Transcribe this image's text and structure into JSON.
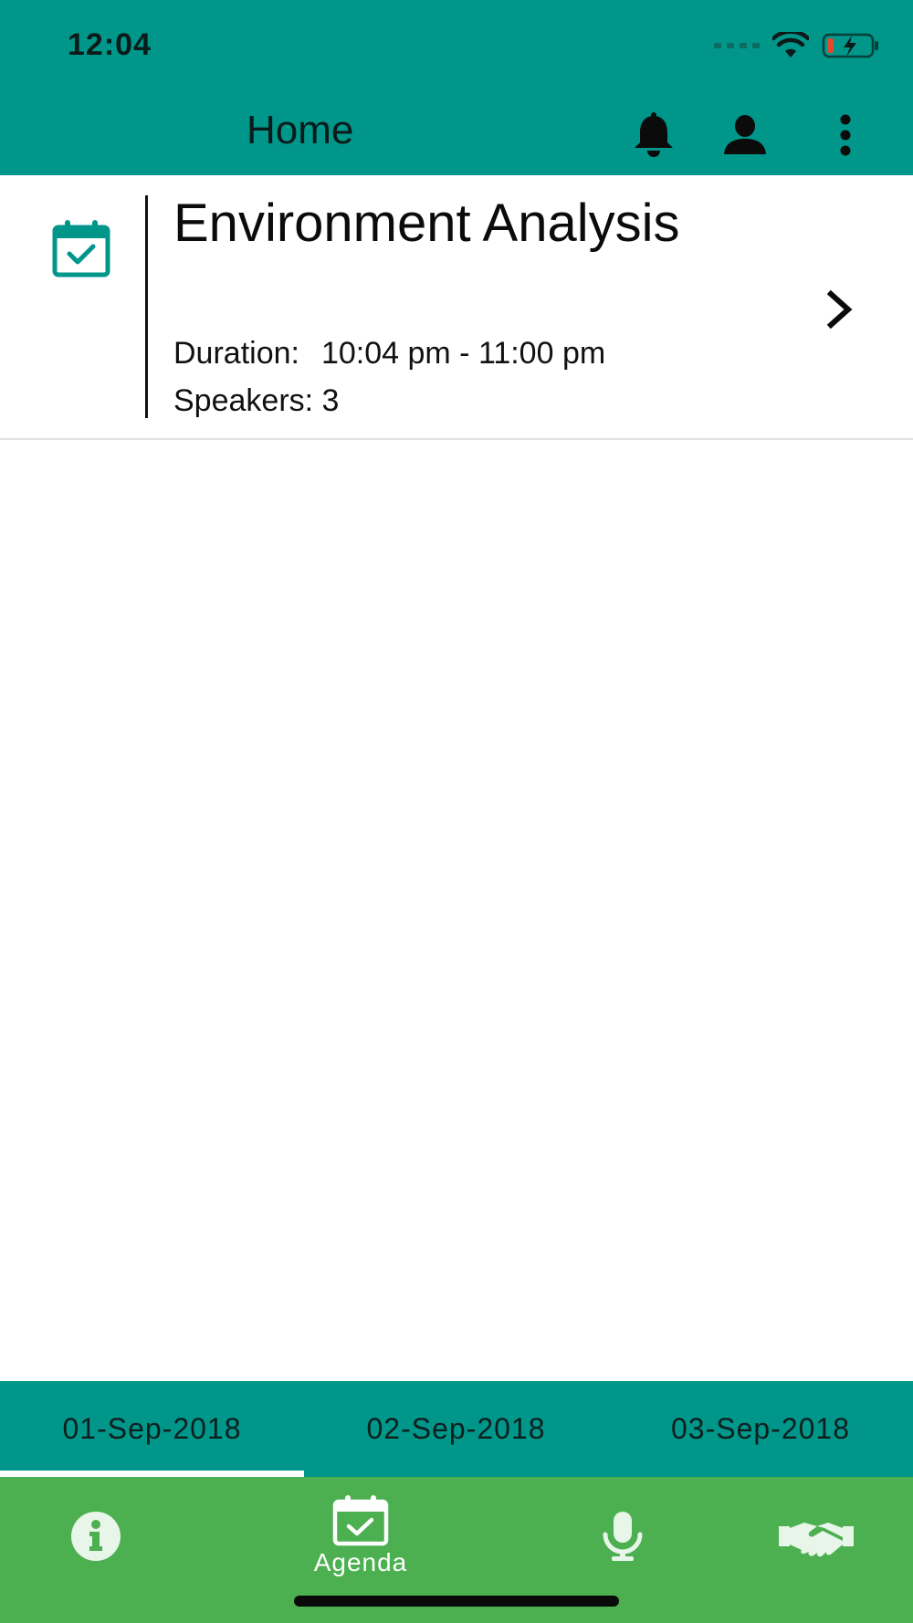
{
  "status_bar": {
    "time": "12:04",
    "icons": [
      "cellular-signal-icon",
      "wifi-icon",
      "battery-charging-icon"
    ]
  },
  "app_bar": {
    "title": "Home",
    "actions": [
      "bell-icon",
      "user-icon",
      "more-vertical-icon"
    ]
  },
  "agenda": {
    "items": [
      {
        "icon": "calendar-check-icon",
        "title": "Environment Analysis",
        "duration_label": "Duration:",
        "duration_value": "10:04 pm - 11:00 pm",
        "speakers_text": "Speakers: 3"
      }
    ]
  },
  "date_tabs": {
    "selected_index": 0,
    "tabs": [
      "01-Sep-2018",
      "02-Sep-2018",
      "03-Sep-2018"
    ]
  },
  "bottom_nav": {
    "selected_index": 1,
    "items": [
      {
        "icon": "info-icon",
        "label": ""
      },
      {
        "icon": "calendar-check-icon",
        "label": "Agenda"
      },
      {
        "icon": "microphone-icon",
        "label": ""
      },
      {
        "icon": "handshake-icon",
        "label": ""
      }
    ]
  },
  "colors": {
    "header_teal": "#00968a",
    "nav_green": "#4caf50",
    "accent_teal": "#00968a"
  }
}
